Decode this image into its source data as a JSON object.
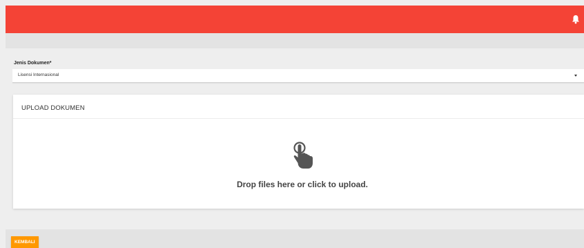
{
  "header": {
    "notification_icon": "bell-icon",
    "color": "#f44336"
  },
  "form": {
    "document_type_label": "Jenis Dokumen*",
    "document_type_value": "Lisensi Internasional"
  },
  "upload": {
    "title": "UPLOAD DOKUMEN",
    "icon": "hand-pointer-icon",
    "message": "Drop files here or click to upload."
  },
  "footer": {
    "back_label": "KEMBALI",
    "back_color": "#ff9800"
  }
}
